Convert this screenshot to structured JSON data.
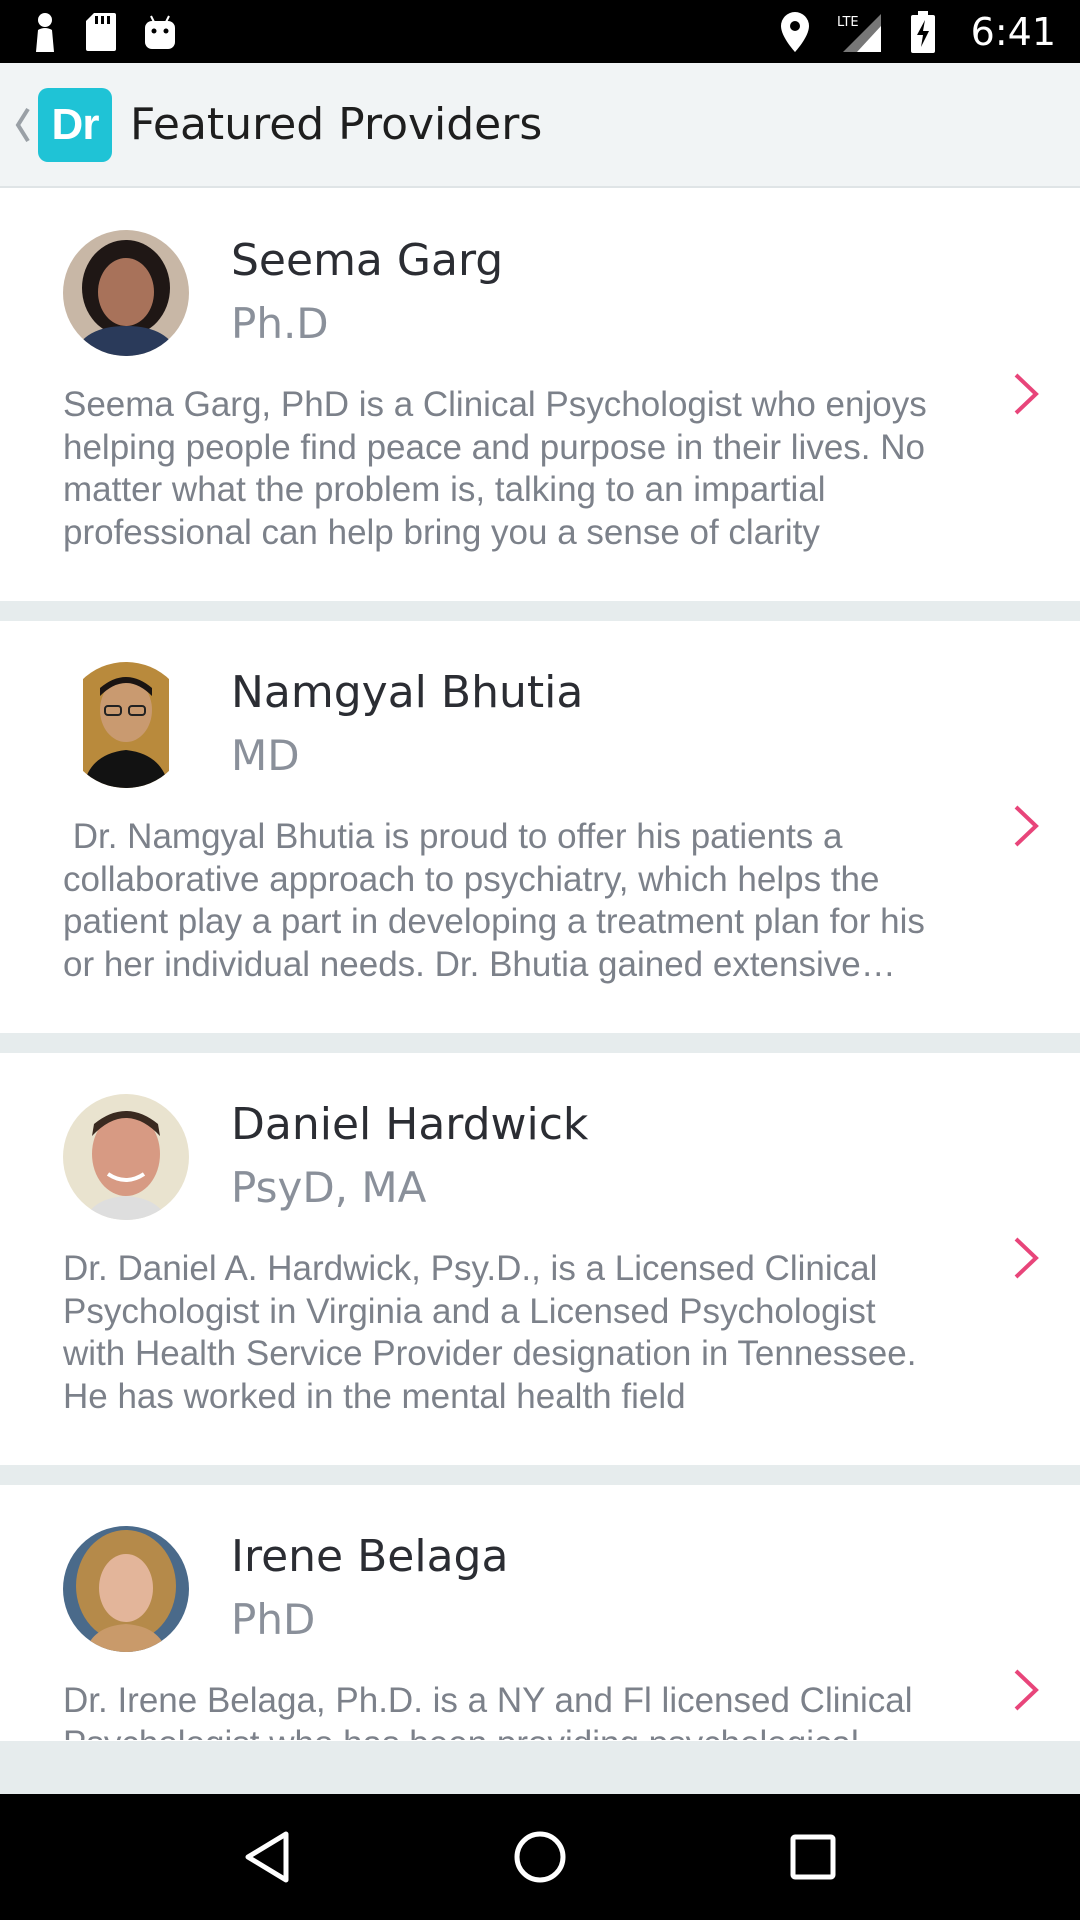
{
  "status_bar": {
    "time": "6:41",
    "network": "LTE",
    "left_icons": [
      "notification-person-icon",
      "sd-card-icon",
      "android-robot-icon"
    ],
    "right_icons": [
      "location-icon",
      "signal-icon",
      "battery-charging-icon"
    ]
  },
  "app_bar": {
    "logo_text": "Dr",
    "title": "Featured Providers",
    "accent_color": "#1fc3d6"
  },
  "providers": [
    {
      "name": "Seema Garg",
      "credential": "Ph.D",
      "bio": "Seema Garg, PhD is a Clinical Psychologist who enjoys helping people find peace and purpose in their lives.  No matter what the problem is, talking to an impartial professional can help bring you a sense of clarity"
    },
    {
      "name": "Namgyal Bhutia",
      "credential": "MD",
      "bio": " Dr. Namgyal Bhutia is proud to offer his patients a collaborative approach to psychiatry, which helps the patient play a part in developing a treatment plan for his or her individual needs. Dr. Bhutia gained extensive experience"
    },
    {
      "name": "Daniel Hardwick",
      "credential": "PsyD, MA",
      "bio": "Dr. Daniel A. Hardwick, Psy.D., is a Licensed Clinical Psychologist in Virginia and a Licensed Psychologist with Health Service Provider designation in Tennessee. He has worked in the mental health field"
    },
    {
      "name": "Irene Belaga",
      "credential": "PhD",
      "bio": "Dr. Irene Belaga, Ph.D. is a NY and Fl licensed Clinical Psychologist who has been providing psychological services"
    }
  ],
  "colors": {
    "chevron": "#e8457a",
    "separator": "#e6eced"
  }
}
